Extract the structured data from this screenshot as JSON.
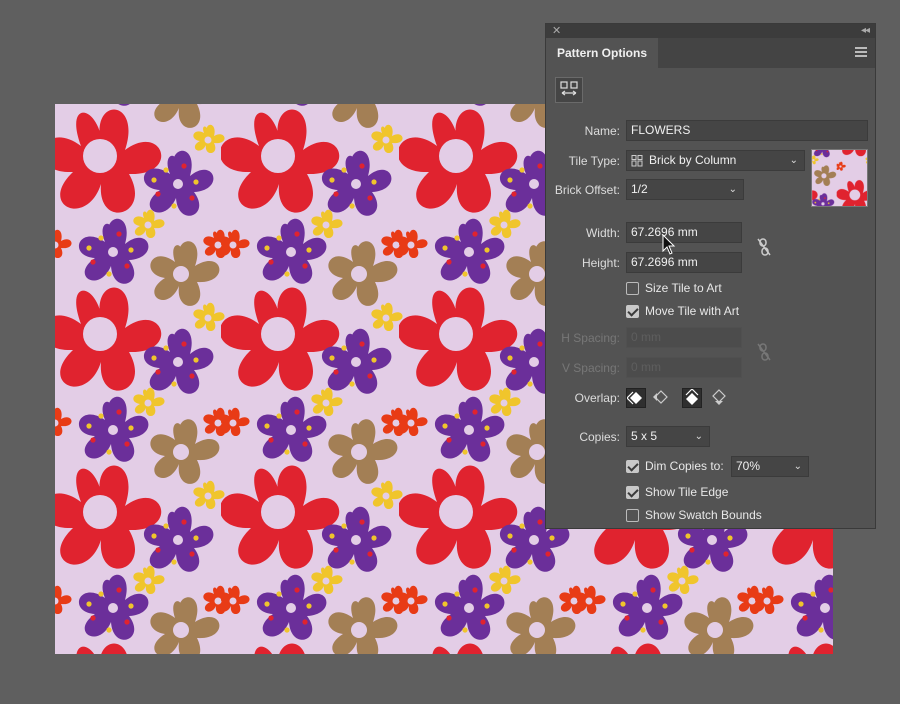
{
  "panel": {
    "title": "Pattern Options",
    "name_label": "Name:",
    "name_value": "FLOWERS",
    "tile_type_label": "Tile Type:",
    "tile_type_value": "Brick by Column",
    "brick_offset_label": "Brick Offset:",
    "brick_offset_value": "1/2",
    "width_label": "Width:",
    "width_value": "67.2696 mm",
    "height_label": "Height:",
    "height_value": "67.2696 mm",
    "size_tile_to_art": {
      "label": "Size Tile to Art",
      "checked": false
    },
    "move_tile_with_art": {
      "label": "Move Tile with Art",
      "checked": true
    },
    "h_spacing_label": "H Spacing:",
    "h_spacing_value": "0 mm",
    "v_spacing_label": "V Spacing:",
    "v_spacing_value": "0 mm",
    "overlap_label": "Overlap:",
    "copies_label": "Copies:",
    "copies_value": "5 x 5",
    "dim_copies": {
      "label": "Dim Copies to:",
      "checked": true,
      "value": "70%"
    },
    "show_tile_edge": {
      "label": "Show Tile Edge",
      "checked": true
    },
    "show_swatch_bounds": {
      "label": "Show Swatch Bounds",
      "checked": false
    }
  },
  "icons": [
    "close-icon",
    "collapse-icon",
    "panel-menu-icon",
    "tile-edit-tool-icon",
    "tile-type-icon",
    "link-proportions-icon",
    "overlap-left-icon",
    "overlap-right-icon",
    "overlap-top-icon",
    "overlap-bottom-icon",
    "cursor-icon"
  ],
  "colors": {
    "canvas_bg": "#e3cde6",
    "red": "#e0232f",
    "purple": "#6b2f9a",
    "brown": "#a37f55",
    "yellow": "#f0c52c",
    "orange": "#e83b16",
    "panel_bg": "#535353"
  }
}
